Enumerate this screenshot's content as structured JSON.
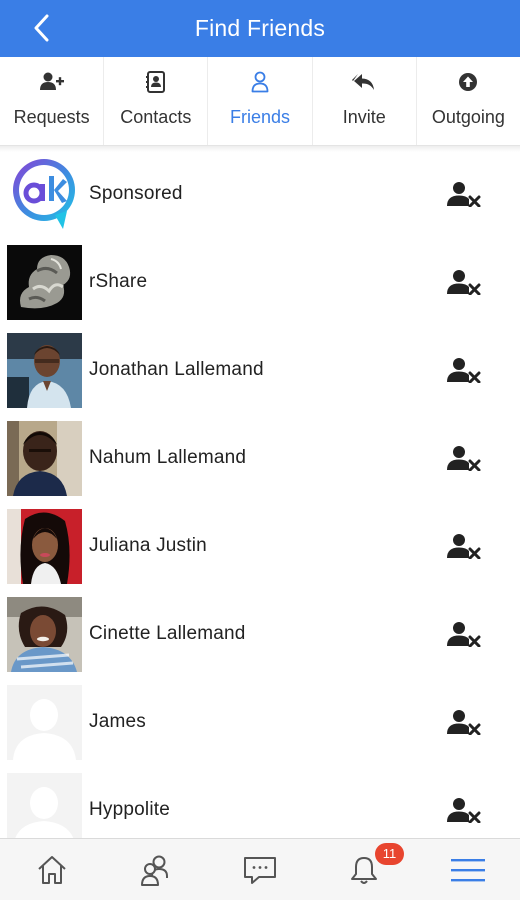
{
  "header": {
    "title": "Find Friends",
    "back_icon": "chevron-left-icon",
    "background": "#3a7ee6"
  },
  "tabs": [
    {
      "label": "Requests",
      "icon": "user-plus-icon",
      "active": false
    },
    {
      "label": "Contacts",
      "icon": "contact-card-icon",
      "active": false
    },
    {
      "label": "Friends",
      "icon": "user-outline-icon",
      "active": true
    },
    {
      "label": "Invite",
      "icon": "reply-arrow-icon",
      "active": false
    },
    {
      "label": "Outgoing",
      "icon": "upload-circle-icon",
      "active": false
    }
  ],
  "friends": [
    {
      "name": "Sponsored",
      "avatar": "ak-logo"
    },
    {
      "name": "rShare",
      "avatar": "photo"
    },
    {
      "name": "Jonathan Lallemand",
      "avatar": "photo"
    },
    {
      "name": "Nahum Lallemand",
      "avatar": "photo"
    },
    {
      "name": "Juliana Justin",
      "avatar": "photo"
    },
    {
      "name": "Cinette Lallemand",
      "avatar": "photo"
    },
    {
      "name": "James",
      "avatar": "default-silhouette"
    },
    {
      "name": "Hyppolite",
      "avatar": "default-silhouette"
    }
  ],
  "row_action_icon": "remove-friend-icon",
  "bottom_nav": {
    "items": [
      {
        "icon": "home-icon"
      },
      {
        "icon": "friends-icon"
      },
      {
        "icon": "chat-bubble-icon"
      },
      {
        "icon": "bell-icon"
      },
      {
        "icon": "menu-icon"
      }
    ],
    "notification_badge": "11",
    "accent": "#3a7ee6",
    "badge_color": "#e8452f"
  }
}
